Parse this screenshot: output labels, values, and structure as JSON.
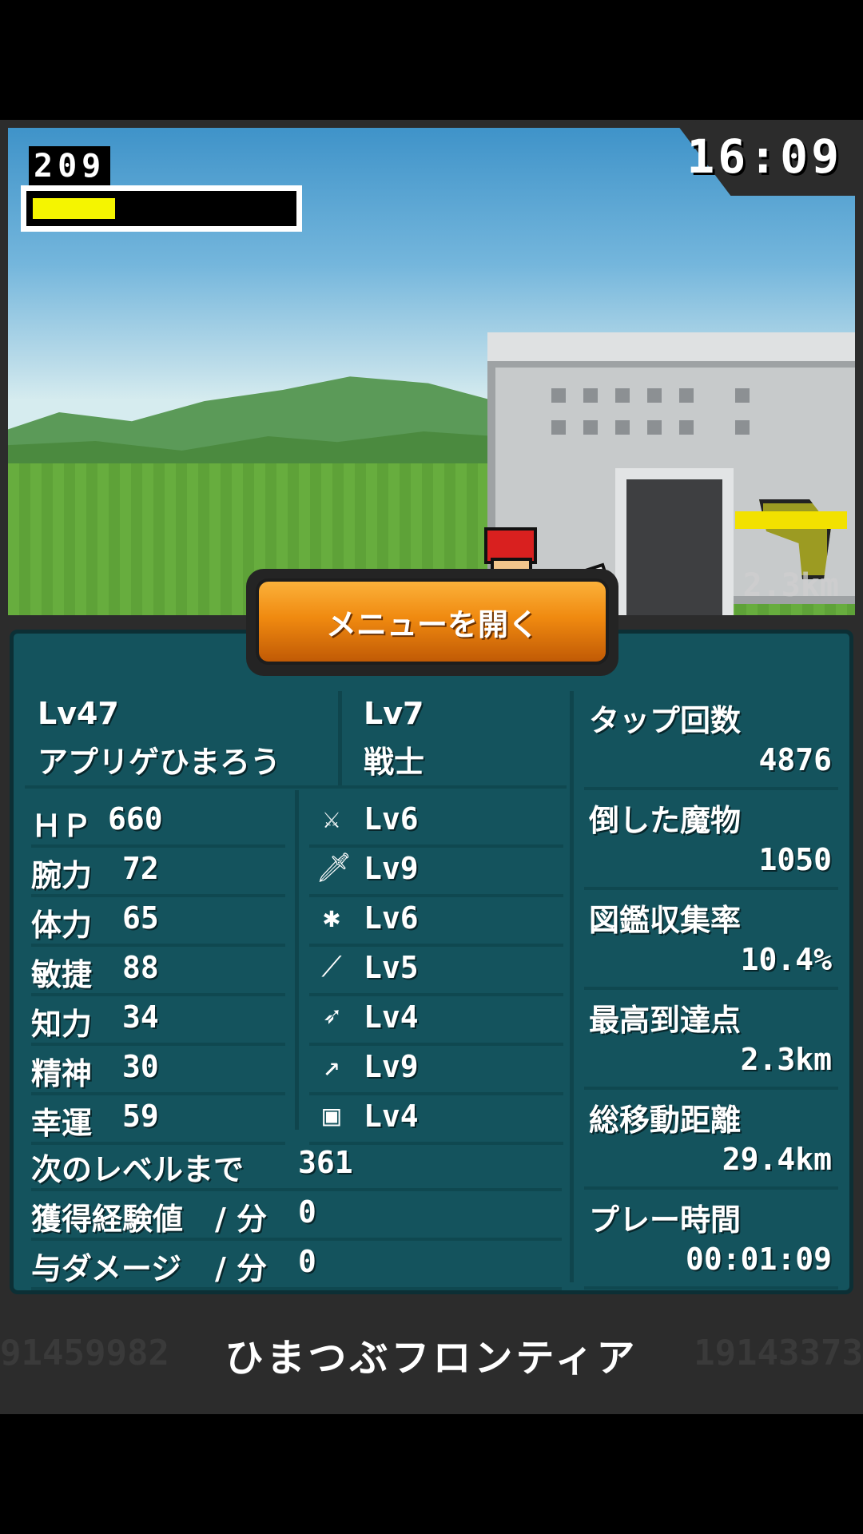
{
  "hud": {
    "hp_value": "209",
    "hp_fill": 0.32,
    "timer": "16:09",
    "distance": "2.3km",
    "distance_fill": 1.0
  },
  "menu": {
    "open_label": "メニューを開く"
  },
  "character": {
    "level": "Lv47",
    "name": "アプリゲひまろう",
    "job_level": "Lv7",
    "job": "戦士"
  },
  "stats": [
    {
      "label": "ＨＰ",
      "value": "660"
    },
    {
      "label": "腕力",
      "value": "72"
    },
    {
      "label": "体力",
      "value": "65"
    },
    {
      "label": "敏捷",
      "value": "88"
    },
    {
      "label": "知力",
      "value": "34"
    },
    {
      "label": "精神",
      "value": "30"
    },
    {
      "label": "幸運",
      "value": "59"
    }
  ],
  "weapons": [
    {
      "icon": "sword-icon",
      "level": "Lv6"
    },
    {
      "icon": "dagger-icon",
      "level": "Lv9"
    },
    {
      "icon": "claw-icon",
      "level": "Lv6"
    },
    {
      "icon": "spear-icon",
      "level": "Lv5"
    },
    {
      "icon": "bow-icon",
      "level": "Lv4"
    },
    {
      "icon": "staff-icon",
      "level": "Lv9"
    },
    {
      "icon": "book-icon",
      "level": "Lv4"
    }
  ],
  "progress": [
    {
      "label": "次のレベルまで",
      "sep": "",
      "value": "361"
    },
    {
      "label": "獲得経験値",
      "sep": "/ 分",
      "value": "0"
    },
    {
      "label": "与ダメージ",
      "sep": "/ 分",
      "value": "0"
    }
  ],
  "records": [
    {
      "label": "タップ回数",
      "value": "4876"
    },
    {
      "label": "倒した魔物",
      "value": "1050"
    },
    {
      "label": "図鑑収集率",
      "value": "10.4%"
    },
    {
      "label": "最高到達点",
      "value": "2.3km"
    },
    {
      "label": "総移動距離",
      "value": "29.4km"
    },
    {
      "label": "プレー時間",
      "value": "00:01:09"
    }
  ],
  "footer": {
    "title": "ひまつぶフロンティア",
    "left_number": "91459982",
    "right_number": "19143373"
  },
  "colors": {
    "panel": "#14535d",
    "hp": "#f5f500",
    "menu_button": "#f08a10"
  }
}
